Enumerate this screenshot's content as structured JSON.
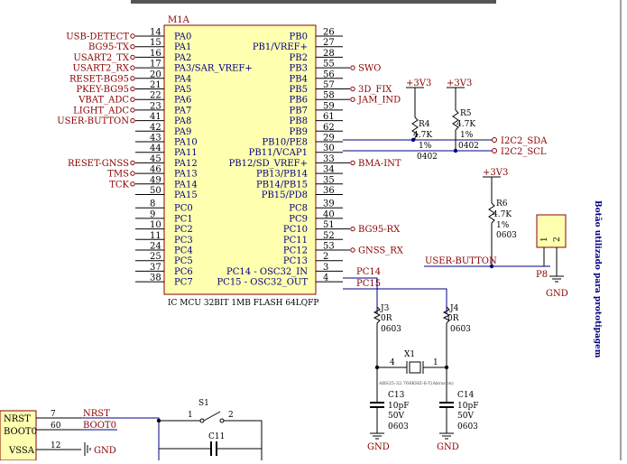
{
  "mcu": {
    "ref": "M1A",
    "description": "IC MCU 32BIT 1MB FLASH 64LQFP",
    "left_pins": [
      {
        "num": "14",
        "name": "PA0",
        "net": "USB-DETECT"
      },
      {
        "num": "15",
        "name": "PA1",
        "net": "BG95-TX"
      },
      {
        "num": "16",
        "name": "PA2",
        "net": "USART2_TX"
      },
      {
        "num": "17",
        "name": "PA3/SAR_VREF+",
        "net": "USART2_RX"
      },
      {
        "num": "20",
        "name": "PA4",
        "net": "RESET-BG95"
      },
      {
        "num": "21",
        "name": "PA5",
        "net": "PKEY-BG95"
      },
      {
        "num": "22",
        "name": "PA6",
        "net": "VBAT_ADC"
      },
      {
        "num": "23",
        "name": "PA7",
        "net": "LIGHT_ADC"
      },
      {
        "num": "41",
        "name": "PA8",
        "net": "USER-BUTTON"
      },
      {
        "num": "42",
        "name": "PA9",
        "net": ""
      },
      {
        "num": "43",
        "name": "PA10",
        "net": ""
      },
      {
        "num": "44",
        "name": "PA11",
        "net": ""
      },
      {
        "num": "45",
        "name": "PA12",
        "net": "RESET-GNSS"
      },
      {
        "num": "46",
        "name": "PA13",
        "net": "TMS"
      },
      {
        "num": "49",
        "name": "PA14",
        "net": "TCK"
      },
      {
        "num": "50",
        "name": "PA15",
        "net": ""
      },
      {
        "num": "8",
        "name": "PC0",
        "net": ""
      },
      {
        "num": "9",
        "name": "PC1",
        "net": ""
      },
      {
        "num": "10",
        "name": "PC2",
        "net": ""
      },
      {
        "num": "11",
        "name": "PC3",
        "net": ""
      },
      {
        "num": "24",
        "name": "PC4",
        "net": ""
      },
      {
        "num": "25",
        "name": "PC5",
        "net": ""
      },
      {
        "num": "37",
        "name": "PC6",
        "net": ""
      },
      {
        "num": "38",
        "name": "PC7",
        "net": ""
      }
    ],
    "right_pins": [
      {
        "num": "26",
        "name": "PB0",
        "net": ""
      },
      {
        "num": "27",
        "name": "PB1/VREF+",
        "net": ""
      },
      {
        "num": "28",
        "name": "PB2",
        "net": ""
      },
      {
        "num": "55",
        "name": "PB3",
        "net": "SWO"
      },
      {
        "num": "56",
        "name": "PB4",
        "net": ""
      },
      {
        "num": "57",
        "name": "PB5",
        "net": "3D_FIX"
      },
      {
        "num": "58",
        "name": "PB6",
        "net": "JAM_IND"
      },
      {
        "num": "59",
        "name": "PB7",
        "net": ""
      },
      {
        "num": "61",
        "name": "PB8",
        "net": ""
      },
      {
        "num": "62",
        "name": "PB9",
        "net": ""
      },
      {
        "num": "29",
        "name": "PB10/PE8",
        "net": ""
      },
      {
        "num": "30",
        "name": "PB11/VCAP1",
        "net": ""
      },
      {
        "num": "33",
        "name": "PB12/SD_VREF+",
        "net": "BMA-INT"
      },
      {
        "num": "34",
        "name": "PB13/PB14",
        "net": ""
      },
      {
        "num": "35",
        "name": "PB14/PB15",
        "net": ""
      },
      {
        "num": "36",
        "name": "PB15/PD8",
        "net": ""
      },
      {
        "num": "39",
        "name": "PC8",
        "net": ""
      },
      {
        "num": "40",
        "name": "PC9",
        "net": ""
      },
      {
        "num": "51",
        "name": "PC10",
        "net": "BG95-RX"
      },
      {
        "num": "52",
        "name": "PC11",
        "net": ""
      },
      {
        "num": "53",
        "name": "PC12",
        "net": "GNSS_RX"
      },
      {
        "num": "2",
        "name": "PC13",
        "net": ""
      },
      {
        "num": "3",
        "name": "PC14 - OSC32_IN",
        "net": ""
      },
      {
        "num": "4",
        "name": "PC15 - OSC32_OUT",
        "net": ""
      }
    ]
  },
  "power": {
    "v33": "+3V3",
    "gnd": "GND"
  },
  "nets": {
    "i2c_sda": "I2C2_SDA",
    "i2c_scl": "I2C2_SCL",
    "pc14": "PC14",
    "pc15": "PC15",
    "user_button": "USER-BUTTON",
    "nrst": "NRST"
  },
  "components": {
    "r4": {
      "ref": "R4",
      "value": "4.7K",
      "tol": "1%",
      "pkg": "0402"
    },
    "r5": {
      "ref": "R5",
      "value": "4.7K",
      "tol": "1%",
      "pkg": "0402"
    },
    "r6": {
      "ref": "R6",
      "value": "4.7K",
      "tol": "1%",
      "pkg": "0603"
    },
    "j3": {
      "ref": "J3",
      "value": "0R",
      "pkg": "0603"
    },
    "j4": {
      "ref": "J4",
      "value": "0R",
      "pkg": "0603"
    },
    "x1": {
      "ref": "X1",
      "part": "ABS25-32.768KHZ-6-T(Abracon)",
      "pin_left": "4",
      "pin_right": "1"
    },
    "c13": {
      "ref": "C13",
      "value": "10pF",
      "voltage": "50V",
      "pkg": "0603"
    },
    "c14": {
      "ref": "C14",
      "value": "10pF",
      "voltage": "50V",
      "pkg": "0603"
    },
    "c11": {
      "ref": "C11"
    },
    "s1": {
      "ref": "S1",
      "pin1": "1",
      "pin2": "2"
    },
    "p8": {
      "ref": "P8",
      "pin1": "1",
      "pin2": "2"
    }
  },
  "side_note": "Botão utilizado para prototipagem",
  "lower_block": {
    "rows": [
      {
        "name": "NRST",
        "num": "7",
        "net": "NRST"
      },
      {
        "name": "BOOT0",
        "num": "60",
        "net": "BOOT0"
      },
      {
        "name": "VSSA",
        "num": "12",
        "net": "GND"
      }
    ]
  }
}
